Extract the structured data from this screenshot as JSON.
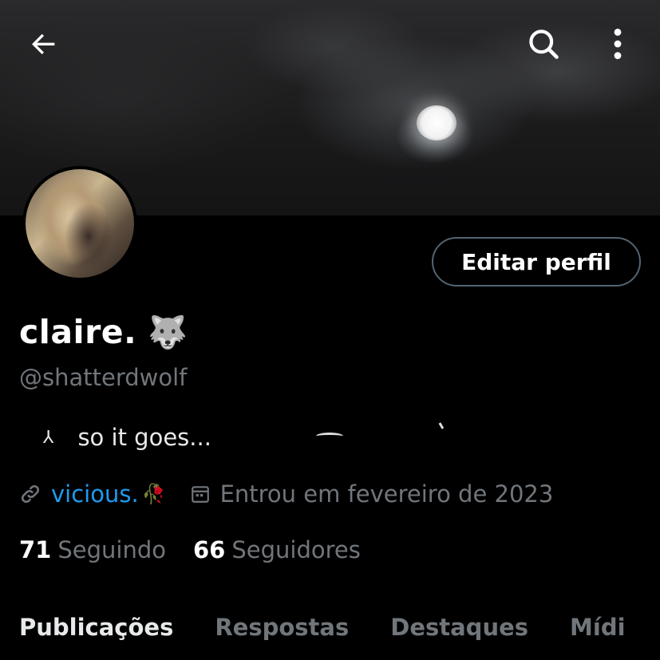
{
  "header": {
    "back_icon": "arrow-left-icon",
    "search_icon": "search-icon",
    "more_icon": "more-vertical-icon"
  },
  "profile": {
    "edit_button_label": "Editar perfil",
    "name": "claire.",
    "name_emoji": "🐺",
    "handle": "@shatterdwolf",
    "bio_icon": "⅄",
    "bio_text": "so it goes...",
    "link_icon": "link-icon",
    "link_text": "vicious.",
    "link_emoji": "🥀",
    "joined_icon": "calendar-icon",
    "joined_text": "Entrou em fevereiro de 2023",
    "following_count": "71",
    "following_label": "Seguindo",
    "followers_count": "66",
    "followers_label": "Seguidores"
  },
  "tabs": [
    {
      "label": "Publicações",
      "active": true
    },
    {
      "label": "Respostas",
      "active": false
    },
    {
      "label": "Destaques",
      "active": false
    },
    {
      "label": "Mídi",
      "active": false
    }
  ],
  "colors": {
    "background": "#000000",
    "text": "#e7e9ea",
    "secondary_text": "#71767b",
    "link": "#1d9bf0",
    "button_border": "#536471"
  }
}
